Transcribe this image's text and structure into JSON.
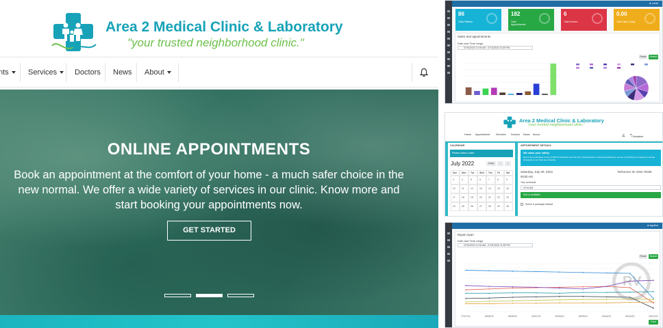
{
  "site": {
    "brand_title": "Area 2 Medical Clinic & Laboratory",
    "brand_tagline": "\"your trusted neighborhood clinic.\"",
    "nav": [
      {
        "label": "nts",
        "has_caret": true
      },
      {
        "label": "Services",
        "has_caret": true
      },
      {
        "label": "Doctors",
        "has_caret": false
      },
      {
        "label": "News",
        "has_caret": false
      },
      {
        "label": "About",
        "has_caret": true
      }
    ],
    "hero": {
      "title": "ONLINE APPOINTMENTS",
      "text": "Book an appointment at the comfort of your home - a much safer choice in the new normal. We offer a wide variety of services in our clinic. Know more and start booking your appointments now.",
      "button": "GET STARTED",
      "slides_total": 3,
      "slide_active": 2
    },
    "colors": {
      "brand_teal": "#17a2b8",
      "brand_green": "#6cc04a",
      "hero_overlay": "#176e5f"
    }
  },
  "dashboard": {
    "stats": [
      {
        "value": "86",
        "label": "Total Patients",
        "color": "#17b3d6",
        "icon": "user-icon"
      },
      {
        "value": "182",
        "label": "Total Appointments",
        "color": "#28a745",
        "icon": "stethoscope-icon"
      },
      {
        "value": "6",
        "label": "Total Doctors",
        "color": "#dc3545",
        "icon": "doctor-icon"
      },
      {
        "value": "0.00",
        "label": "Total Sales Today",
        "color": "#f0ad1b",
        "icon": "money-icon"
      }
    ],
    "section_title": "Sales and appointments",
    "range_label": "Date and Time range",
    "range_value": "07/01/2022 12:00 AM - 07/11/2022 11:59 PM",
    "reset_label": "Reset",
    "search_label": "Search",
    "bar_values": [
      19,
      10,
      16,
      18,
      6,
      3,
      5,
      9,
      28,
      3,
      78
    ],
    "bar_colors": [
      "#8b5a4a",
      "#6b5fd1",
      "#39d353",
      "#b43cb6",
      "#4b3a2c",
      "#4aa3d9",
      "#1e1e6e",
      "#8a5a36",
      "#2a3fd6",
      "#4a4a4a",
      "#7ee06b"
    ],
    "bar_ylim": [
      0,
      2500
    ],
    "pie_values": [
      18,
      12,
      9,
      14,
      10,
      8,
      11,
      7,
      6,
      5
    ],
    "pie_colors": [
      "#8e6bc9",
      "#b56ad8",
      "#5a3fb0",
      "#d49ae6",
      "#3b2e7c",
      "#7a9bd6",
      "#c77dd6",
      "#5e5bb6",
      "#aa86e0",
      "#9f3fb3"
    ]
  },
  "booking": {
    "brand_title": "Area 2 Medical Clinic & Laboratory",
    "brand_tagline": "\"your trusted neighborhood clinic.\"",
    "nav": [
      "Home",
      "Appointment",
      "Services",
      "Doctors",
      "News",
      "About"
    ],
    "user": "Chrisatine",
    "calendar_header": "CALENDAR",
    "calendar_note": "Please select a date",
    "month": "July 2022",
    "today_label": "today",
    "weekdays": [
      "Sun",
      "Mon",
      "Tue",
      "Wed",
      "Thu",
      "Fri",
      "Sat"
    ],
    "weeks": [
      [
        "3",
        "4",
        "5",
        "6",
        "7",
        "8",
        "9"
      ],
      [
        "10",
        "11",
        "12",
        "13",
        "14",
        "15",
        "16"
      ],
      [
        "17",
        "18",
        "19",
        "20",
        "21",
        "22",
        "23"
      ],
      [
        "24",
        "25",
        "26",
        "27",
        "28",
        "29",
        "30"
      ]
    ],
    "details_header": "APPOINTMENT DETAILS",
    "notice_title": "We value your safety.",
    "notice_text": "Due to the restrictions of the COVID-19 Pandemic and the strict implementation of physical distancing, we are only limiting our capacity to accept 20 people in our clinic per schedule.",
    "date_text": "Saturday, July 30, 2022",
    "time_text": "09:00 AM",
    "reference": "Reference ID: 2022-78329",
    "schedule_label": "Your schedule",
    "schedule_value": "09:00 AM",
    "slot_text": "Slot is available",
    "package_text": "Select a package instead"
  },
  "report": {
    "title": "Bayan ayan",
    "range_label": "Date and Time range",
    "range_value": "07/01/2022 12:00 AM - 07/31/2022 11:59 PM",
    "reset_label": "Reset",
    "search_label": "Search",
    "print_label": "Print",
    "x_labels": [
      "07/07/22",
      "06/08/22",
      "06/09/22",
      "06/07/22",
      "06/06/22",
      "06/05/22",
      "06/04/22",
      "06/03/22",
      "06/02/22"
    ],
    "series": [
      {
        "color": "#2f8cd8",
        "values": [
          95,
          94,
          93,
          92,
          91,
          90,
          89,
          88,
          30
        ]
      },
      {
        "color": "#e05b4b",
        "values": [
          50,
          52,
          54,
          55,
          56,
          57,
          58,
          55,
          20
        ]
      },
      {
        "color": "#1a9aa6",
        "values": [
          42,
          42,
          43,
          43,
          42,
          44,
          44,
          45,
          46
        ]
      },
      {
        "color": "#7a3fb8",
        "values": [
          60,
          58,
          57,
          56,
          54,
          52,
          58,
          70,
          72
        ]
      },
      {
        "color": "#c0c44a",
        "values": [
          22,
          24,
          25,
          26,
          27,
          28,
          28,
          29,
          28
        ]
      },
      {
        "color": "#2e3a46",
        "values": [
          30,
          31,
          33,
          34,
          35,
          35,
          34,
          33,
          8
        ]
      },
      {
        "color": "#e8a33a",
        "values": [
          18,
          18,
          19,
          19,
          20,
          20,
          20,
          21,
          22
        ]
      }
    ],
    "ylim": [
      0,
      110
    ]
  },
  "watermark": "RV"
}
